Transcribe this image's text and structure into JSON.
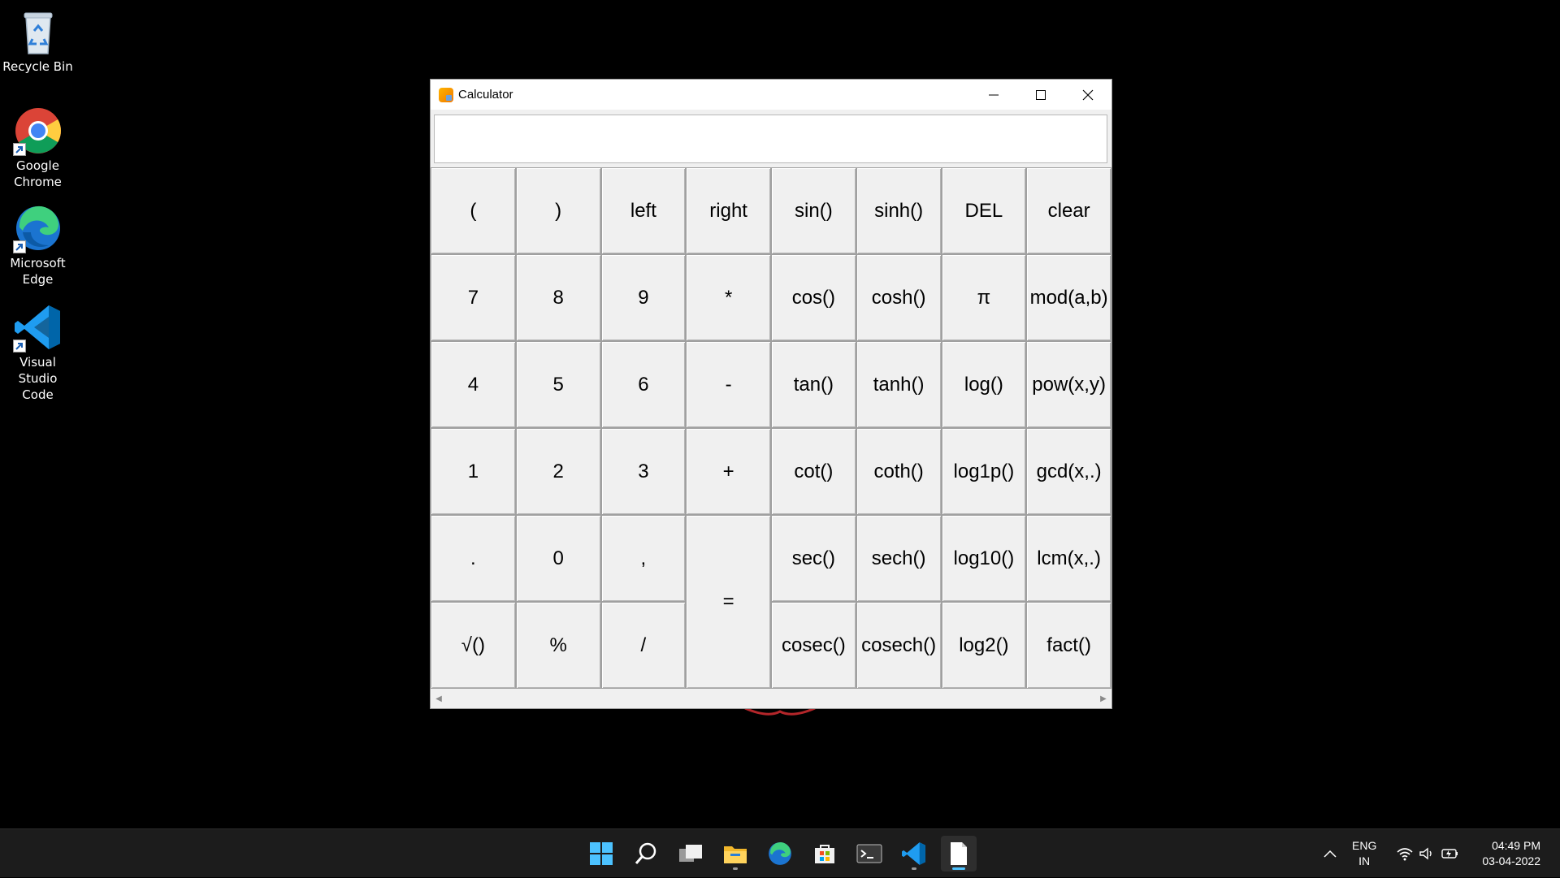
{
  "desktop": {
    "icons": [
      {
        "label": "Recycle Bin",
        "icon": "recycle-bin-icon"
      },
      {
        "label": "Google Chrome",
        "icon": "chrome-icon"
      },
      {
        "label": "Microsoft Edge",
        "icon": "edge-icon"
      },
      {
        "label": "Visual Studio Code",
        "icon": "vscode-icon"
      }
    ]
  },
  "window": {
    "title": "Calculator",
    "display_value": "",
    "caption": {
      "minimize": "minimize-icon",
      "maximize": "maximize-icon",
      "close": "close-icon"
    }
  },
  "keys": {
    "open_paren": "(",
    "close_paren": ")",
    "left": "left",
    "right": "right",
    "sin": "sin()",
    "sinh": "sinh()",
    "del": "DEL",
    "clear": "clear",
    "seven": "7",
    "eight": "8",
    "nine": "9",
    "multiply": "*",
    "cos": "cos()",
    "cosh": "cosh()",
    "pi": "π",
    "mod": "mod(a,b)",
    "four": "4",
    "five": "5",
    "six": "6",
    "minus": "-",
    "tan": "tan()",
    "tanh": "tanh()",
    "log": "log()",
    "pow": "pow(x,y)",
    "one": "1",
    "two": "2",
    "three": "3",
    "plus": "+",
    "cot": "cot()",
    "coth": "coth()",
    "log1p": "log1p()",
    "gcd": "gcd(x,.)",
    "dot": ".",
    "zero": "0",
    "comma": ",",
    "equals": "=",
    "sec": "sec()",
    "sech": "sech()",
    "log10": "log10()",
    "lcm": "lcm(x,.)",
    "sqrt": "√()",
    "percent": "%",
    "divide": "/",
    "cosec": "cosec()",
    "cosech": "cosech()",
    "log2": "log2()",
    "fact": "fact()"
  },
  "taskbar": {
    "apps": [
      "start-icon",
      "search-icon",
      "task-view-icon",
      "file-explorer-icon",
      "edge-icon",
      "store-icon",
      "terminal-icon",
      "vscode-icon",
      "notepad-icon"
    ],
    "language": "ENG",
    "region": "IN",
    "time": "04:49 PM",
    "date": "03-04-2022"
  }
}
